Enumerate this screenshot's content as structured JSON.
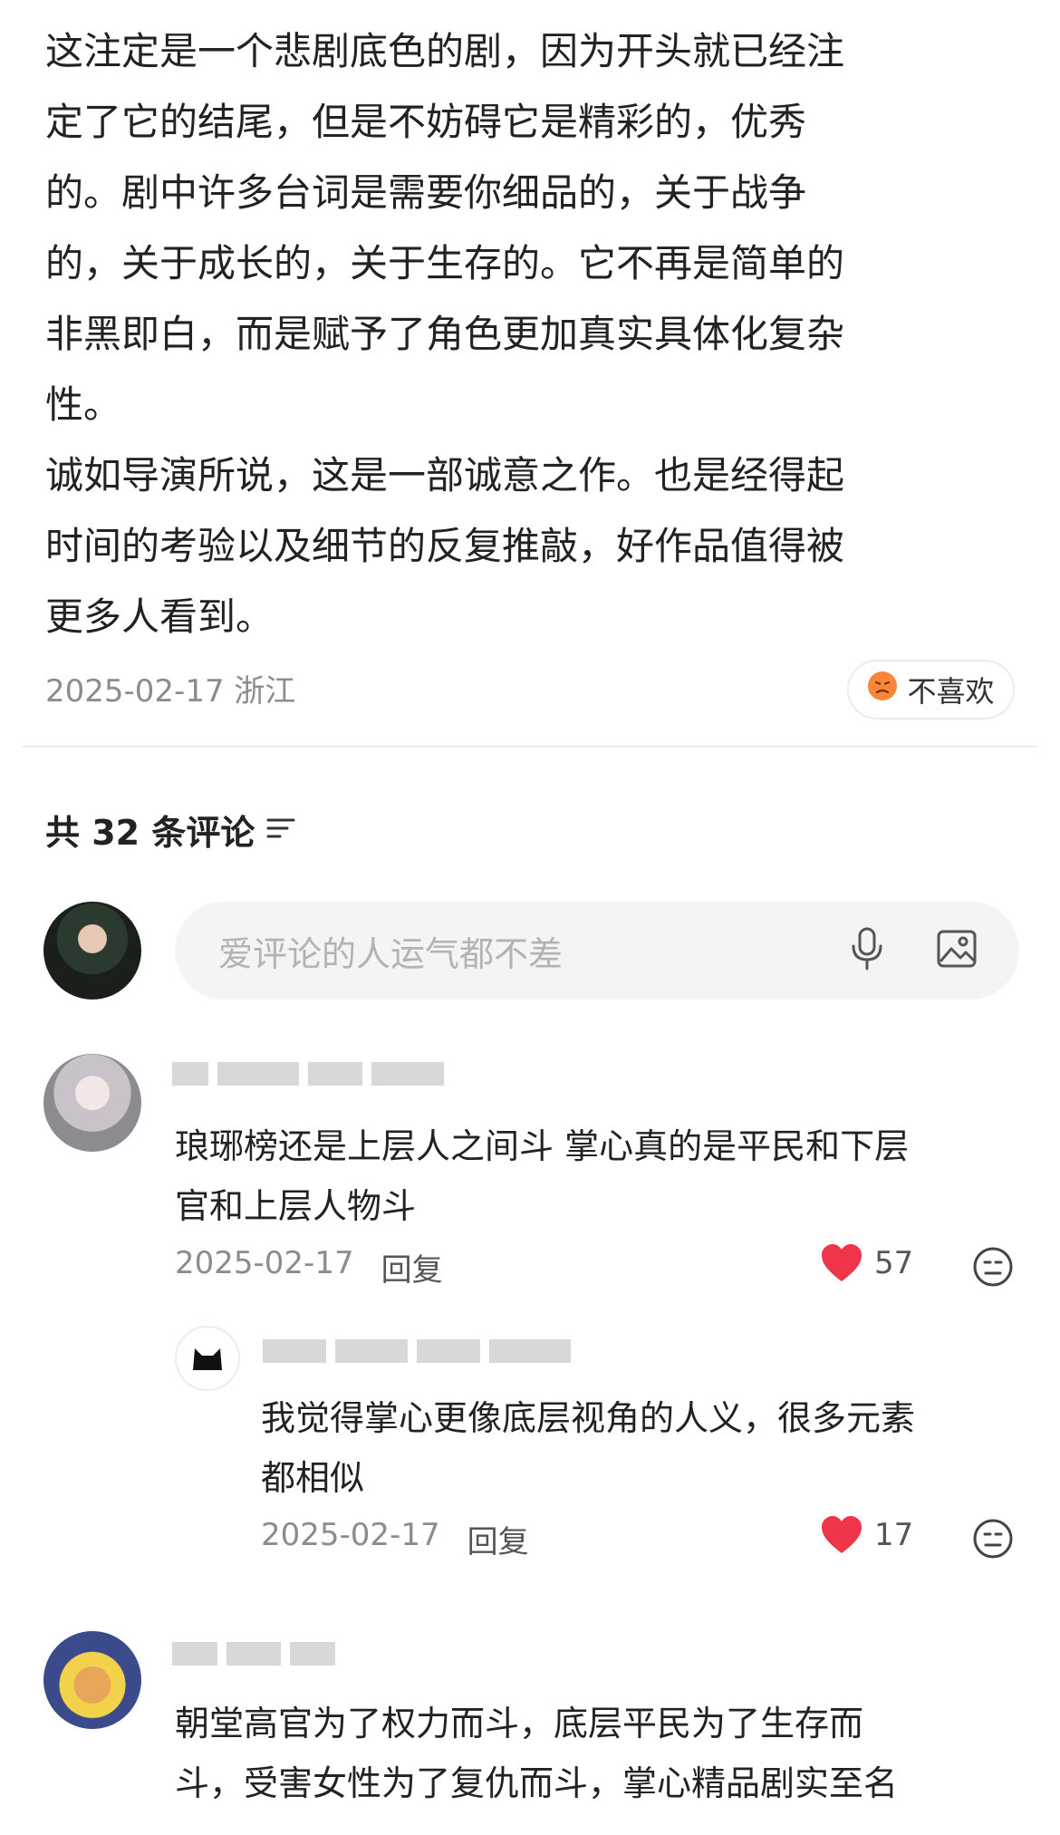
{
  "article": {
    "lines": [
      "这注定是一个悲剧底色的剧，因为开头就已经注",
      "定了它的结尾，但是不妨碍它是精彩的，优秀",
      "的。剧中许多台词是需要你细品的，关于战争",
      "的，关于成长的，关于生存的。它不再是简单的",
      "非黑即白，而是赋予了角色更加真实具体化复杂",
      "性。",
      "诚如导演所说，这是一部诚意之作。也是经得起",
      "时间的考验以及细节的反复推敲，好作品值得被",
      "更多人看到。"
    ],
    "date": "2025-02-17",
    "location": "浙江",
    "dislike_label": "不喜欢"
  },
  "comments_header": {
    "title": "共 32 条评论"
  },
  "comment_input": {
    "placeholder": "爱评论的人运气都不差"
  },
  "comments": [
    {
      "text_lines": [
        "琅琊榜还是上层人之间斗 掌心真的是平民和下层",
        "官和上层人物斗"
      ],
      "date": "2025-02-17",
      "reply_label": "回复",
      "likes": "57"
    },
    {
      "text_lines": [
        "我觉得掌心更像底层视角的人义，很多元素",
        "都相似"
      ],
      "date": "2025-02-17",
      "reply_label": "回复",
      "likes": "17"
    },
    {
      "text_lines": [
        "朝堂高官为了权力而斗，底层平民为了生存而",
        "斗，受害女性为了复仇而斗，掌心精品剧实至名"
      ]
    }
  ],
  "colors": {
    "heart": "#f0344a",
    "text": "#222222",
    "meta": "#8c8c8c",
    "dislike_face": "#f7863a"
  }
}
